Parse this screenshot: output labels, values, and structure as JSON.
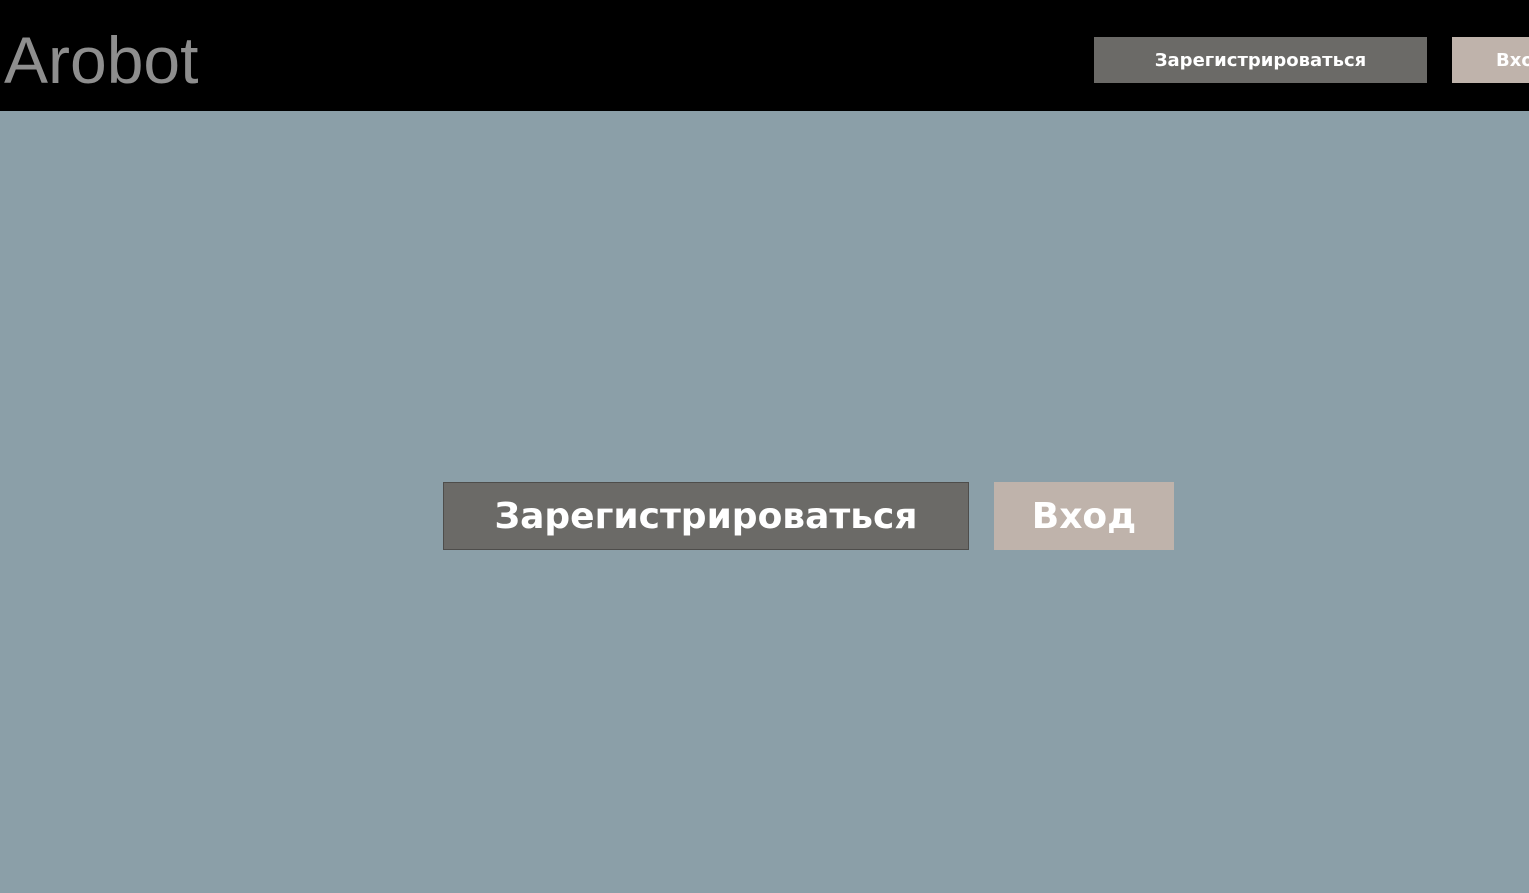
{
  "header": {
    "logo_text": "Arobot",
    "register_label": "Зарегистрироваться",
    "login_label": "Вход"
  },
  "hero": {
    "register_label": "Зарегистрироваться",
    "login_label": "Вход"
  },
  "colors": {
    "header_background": "#000000",
    "page_background": "#8b9fa8",
    "logo_text": "#8e8e8e",
    "register_button": "#6b6a67",
    "login_button": "#bfb3ab",
    "button_text": "#ffffff"
  }
}
